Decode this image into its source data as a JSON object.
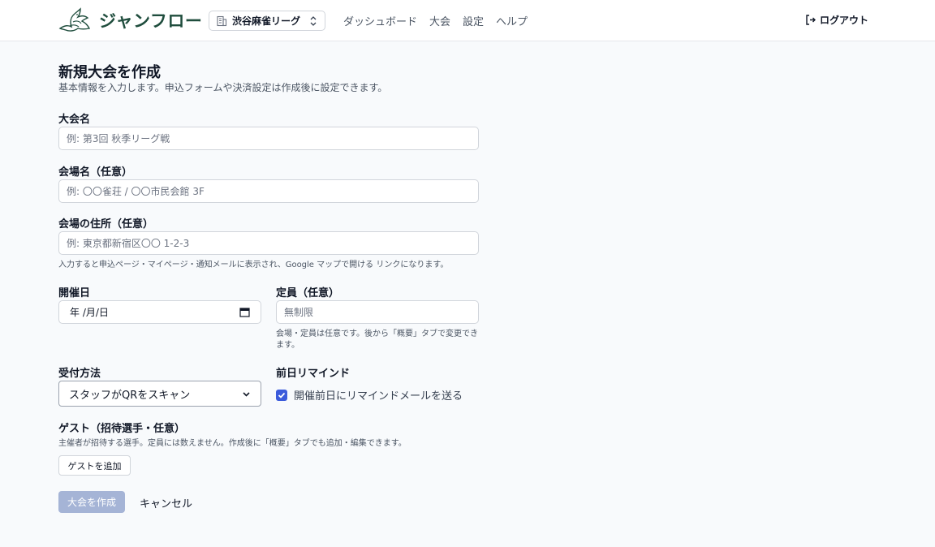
{
  "header": {
    "brand": "ジャンフロー",
    "org": "渋谷麻雀リーグ",
    "nav": [
      "ダッシュボード",
      "大会",
      "設定",
      "ヘルプ"
    ],
    "logout": "ログアウト"
  },
  "page": {
    "title": "新規大会を作成",
    "subtitle": "基本情報を入力します。申込フォームや決済設定は作成後に設定できます。"
  },
  "form": {
    "name_label": "大会名",
    "name_placeholder": "例: 第3回 秋季リーグ戦",
    "venue_label": "会場名（任意）",
    "venue_placeholder": "例: 〇〇雀荘 / 〇〇市民会館 3F",
    "address_label": "会場の住所（任意）",
    "address_placeholder": "例: 東京都新宿区〇〇 1-2-3",
    "address_help": "入力すると申込ページ・マイページ・通知メールに表示され、Google マップで開ける リンクになります。",
    "date_label": "開催日",
    "date_value": "年 /月/日",
    "capacity_label": "定員（任意）",
    "capacity_placeholder": "無制限",
    "capacity_help": "会場・定員は任意です。後から「概要」タブで変更できます。",
    "reception_label": "受付方法",
    "reception_value": "スタッフがQRをスキャン",
    "remind_label": "前日リマインド",
    "remind_text": "開催前日にリマインドメールを送る",
    "remind_checked": true,
    "guest_label": "ゲスト（招待選手・任意）",
    "guest_help": "主催者が招待する選手。定員には数えません。作成後に「概要」タブでも追加・編集できます。",
    "guest_button": "ゲストを追加",
    "submit": "大会を作成",
    "cancel": "キャンセル"
  }
}
